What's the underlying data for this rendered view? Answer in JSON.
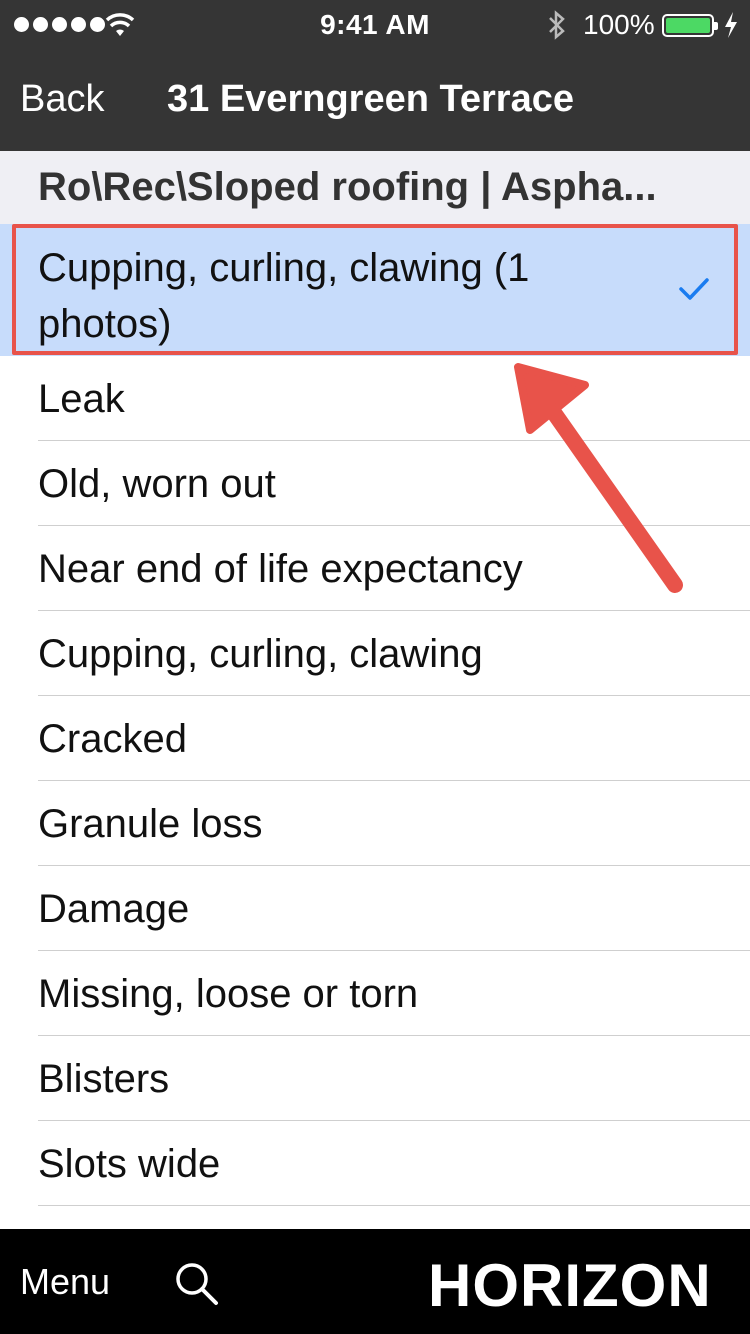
{
  "status_bar": {
    "time": "9:41 AM",
    "battery_percent": "100%",
    "battery_level": 1.0,
    "battery_color": "#4cd964",
    "icons": [
      "signal-dots",
      "wifi-icon",
      "bluetooth-icon",
      "battery-icon",
      "charging-bolt-icon"
    ]
  },
  "nav": {
    "back_label": "Back",
    "title": "31 Everngreen Terrace"
  },
  "section": {
    "title": "Ro\\Rec\\Sloped roofing | Aspha..."
  },
  "list": {
    "selected": {
      "label": "Cupping, curling, clawing (1 photos)",
      "checked": true
    },
    "items": [
      "Leak",
      "Old, worn out",
      "Near end of life expectancy",
      "Cupping, curling, clawing",
      "Cracked",
      "Granule loss",
      "Damage",
      "Missing, loose or torn",
      "Blisters",
      "Slots wide"
    ]
  },
  "annotation": {
    "color": "#e8534a",
    "type": "arrow-and-box"
  },
  "colors": {
    "nav_bg": "#353535",
    "selected_bg": "#c7dcfb",
    "check": "#1a7cf0",
    "section_bg": "#efeff4"
  },
  "toolbar": {
    "menu_label": "Menu",
    "search_icon": "search-icon",
    "logo": "HORIZON"
  }
}
